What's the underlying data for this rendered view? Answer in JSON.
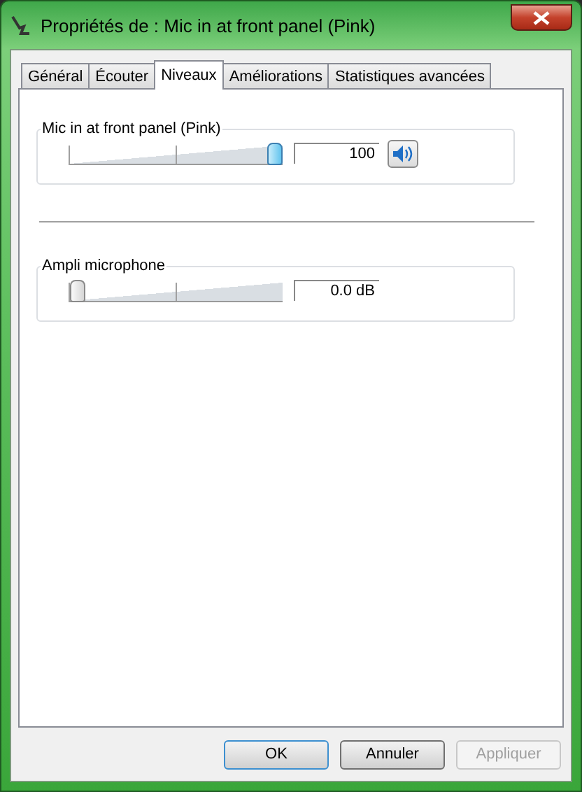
{
  "window": {
    "title": "Propriétés de : Mic in at front panel (Pink)"
  },
  "tabs": [
    {
      "label": "Général",
      "selected": false
    },
    {
      "label": "Écouter",
      "selected": false
    },
    {
      "label": "Niveaux",
      "selected": true
    },
    {
      "label": "Améliorations",
      "selected": false
    },
    {
      "label": "Statistiques avancées",
      "selected": false
    }
  ],
  "levels": [
    {
      "kind": "volume",
      "label": "Mic in at front panel (Pink)",
      "level": 1,
      "value": "100",
      "muted": false
    },
    {
      "kind": "gain",
      "label": "Ampli microphone",
      "level": 0,
      "value": "0.0 dB"
    }
  ],
  "buttons": [
    {
      "label": "OK",
      "default": true,
      "disabled": false
    },
    {
      "label": "Annuler",
      "default": false,
      "disabled": false
    },
    {
      "label": "Appliquer",
      "default": false,
      "disabled": true
    }
  ]
}
